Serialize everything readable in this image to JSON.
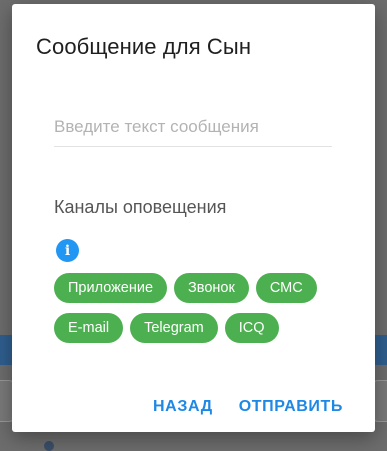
{
  "dialog": {
    "title": "Сообщение для Сын",
    "message_input": {
      "placeholder": "Введите текст сообщения",
      "value": ""
    },
    "channels_title": "Каналы оповещения",
    "info_icon": "info-icon",
    "channels": {
      "row1": [
        "Приложение",
        "Звонок",
        "СМС"
      ],
      "row2": [
        "E-mail",
        "Telegram",
        "ICQ"
      ]
    },
    "actions": {
      "back": "НАЗАД",
      "send": "ОТПРАВИТЬ"
    }
  },
  "colors": {
    "chip": "#4caf50",
    "accent": "#1e88e5",
    "info": "#2196f3"
  }
}
